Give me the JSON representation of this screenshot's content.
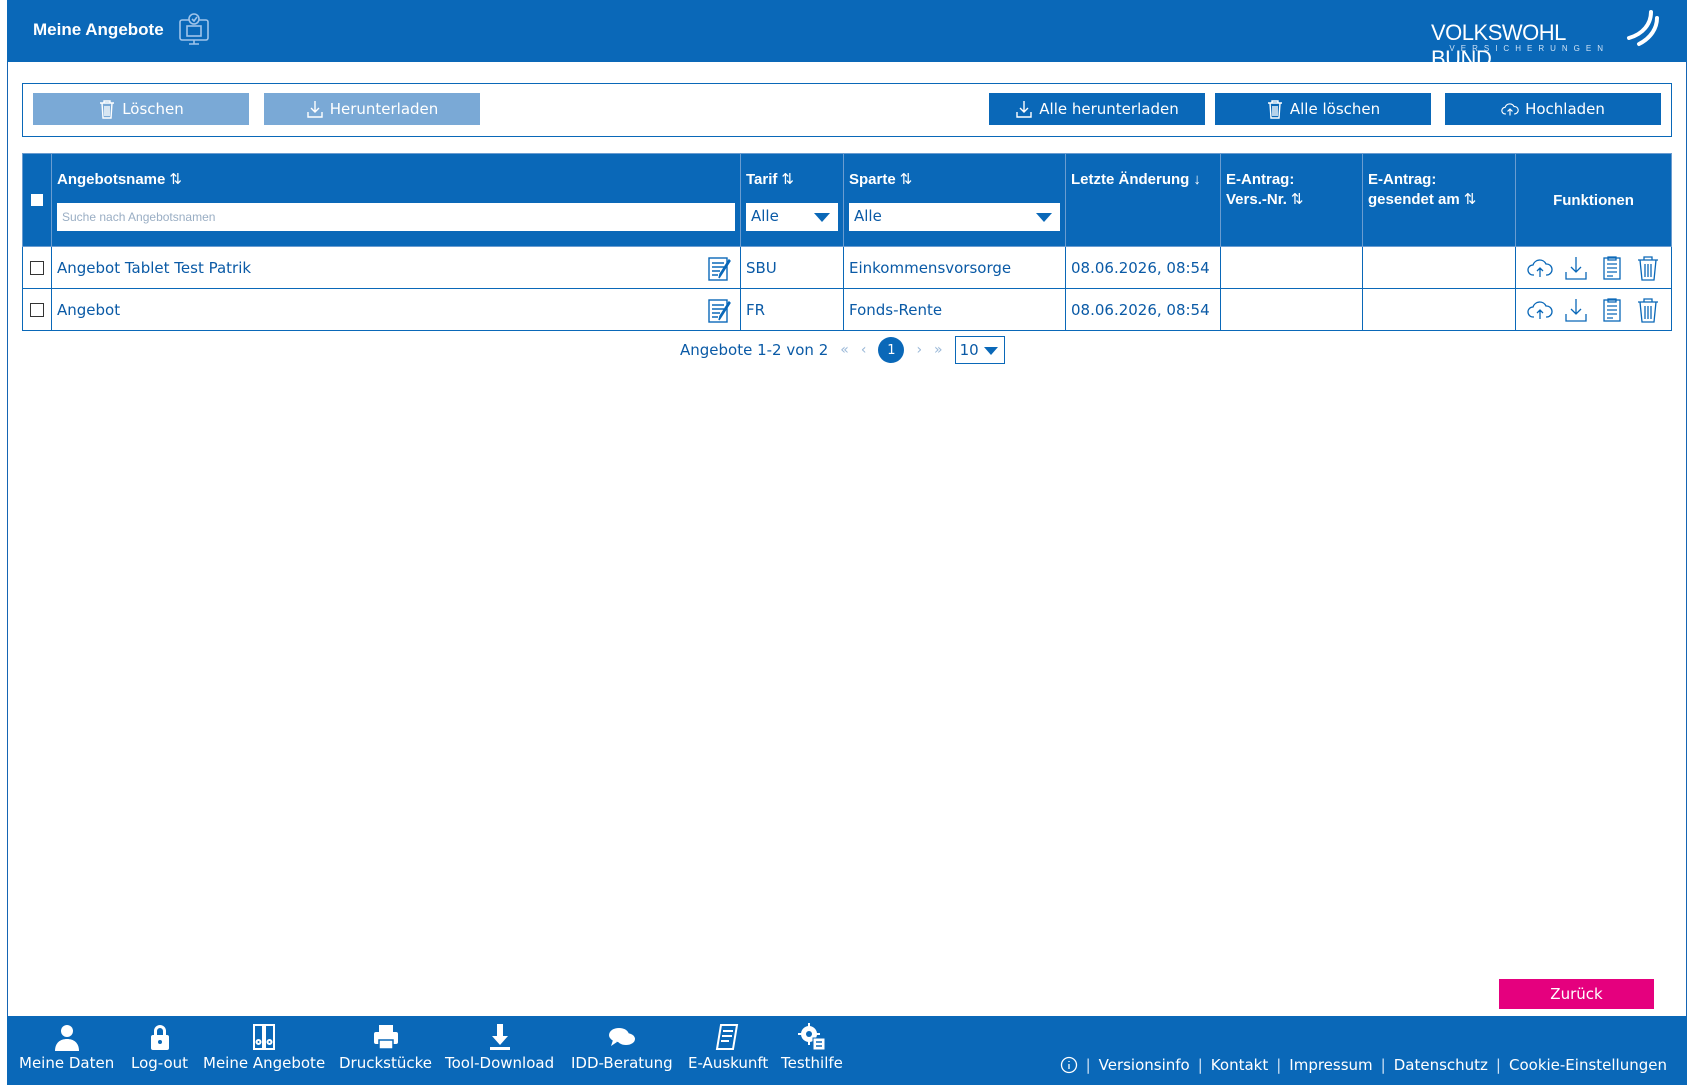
{
  "header": {
    "title": "Meine Angebote",
    "logo_main": "VOLKSWOHL BUND",
    "logo_sub": "VERSICHERUNGEN"
  },
  "toolbar": {
    "delete_label": "Löschen",
    "download_label": "Herunterladen",
    "download_all_label": "Alle herunterladen",
    "delete_all_label": "Alle löschen",
    "upload_label": "Hochladen"
  },
  "table": {
    "columns": {
      "name": "Angebotsname",
      "tarif": "Tarif",
      "sparte": "Sparte",
      "changed": "Letzte Änderung",
      "vers_nr_1": "E-Antrag:",
      "vers_nr_2": "Vers.-Nr.",
      "sent_1": "E-Antrag:",
      "sent_2": "gesendet am",
      "functions": "Funktionen"
    },
    "search_placeholder": "Suche nach Angebotsnamen",
    "tarif_filter": "Alle",
    "sparte_filter": "Alle",
    "rows": [
      {
        "name": "Angebot Tablet Test Patrik",
        "tarif": "SBU",
        "sparte": "Einkommensvorsorge",
        "changed": "08.06.2026, 08:54",
        "vers_nr": "",
        "sent": ""
      },
      {
        "name": "Angebot",
        "tarif": "FR",
        "sparte": "Fonds-Rente",
        "changed": "08.06.2026, 08:54",
        "vers_nr": "",
        "sent": ""
      }
    ]
  },
  "pagination": {
    "summary": "Angebote 1-2 von 2",
    "first": "«",
    "prev": "‹",
    "current": "1",
    "next": "›",
    "last": "»",
    "page_size": "10"
  },
  "back_label": "Zurück",
  "footer": {
    "nav": [
      {
        "label": "Meine Daten",
        "icon": "person-icon"
      },
      {
        "label": "Log-out",
        "icon": "lock-icon"
      },
      {
        "label": "Meine Angebote",
        "icon": "binders-icon"
      },
      {
        "label": "Druckstücke",
        "icon": "printer-icon"
      },
      {
        "label": "Tool-Download",
        "icon": "download-icon"
      },
      {
        "label": "IDD-Beratung",
        "icon": "chat-icon"
      },
      {
        "label": "E-Auskunft",
        "icon": "document-icon"
      },
      {
        "label": "Testhilfe",
        "icon": "gear-icon"
      }
    ],
    "links": [
      "Versionsinfo",
      "Kontakt",
      "Impressum",
      "Datenschutz",
      "Cookie-Einstellungen"
    ]
  },
  "colors": {
    "primary": "#0a68b8",
    "disabled": "#7aa9d6",
    "accent": "#e5007e"
  }
}
